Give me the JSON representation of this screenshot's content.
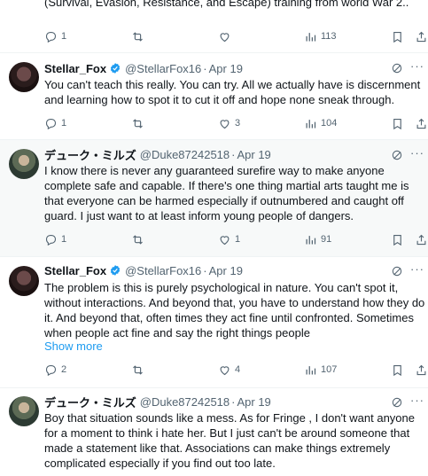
{
  "colors": {
    "text": "#0f1419",
    "secondary": "#536471",
    "link": "#1d9bf0",
    "verified": "#1d9bf0",
    "alt_bg": "#f7f9f9"
  },
  "top_tweet": {
    "text_partial": "(Survival, Evasion, Resistance, and Escape) training from world War 2..",
    "replies": "1",
    "views": "113"
  },
  "tweets": [
    {
      "name": "Stellar_Fox",
      "handle": "@StellarFox16",
      "sep": "·",
      "time": "Apr 19",
      "text": "You can't teach this really. You can try. All we actually have is discernment and learning how to spot it to cut it off and hope none sneak through.",
      "replies": "1",
      "retweets": "",
      "likes": "3",
      "views": "104"
    },
    {
      "name": "デューク・ミルズ",
      "handle": "@Duke87242518",
      "sep": "·",
      "time": "Apr 19",
      "text": "I know there is never any guaranteed surefire way to make anyone complete safe and capable. If there's one thing martial arts taught me is that everyone can be harmed especially if outnumbered and caught off guard. I just want to at least inform young people of dangers.",
      "replies": "1",
      "retweets": "",
      "likes": "1",
      "views": "91"
    },
    {
      "name": "Stellar_Fox",
      "handle": "@StellarFox16",
      "sep": "·",
      "time": "Apr 19",
      "text": "The problem is this is purely psychological in nature. You can't spot it, without interactions. And beyond that, you have to understand how they do it. And beyond that, often times they act fine until confronted. Sometimes when people act fine and say the right things people",
      "show_more": "Show more",
      "replies": "2",
      "retweets": "",
      "likes": "4",
      "views": "107"
    },
    {
      "name": "デューク・ミルズ",
      "handle": "@Duke87242518",
      "sep": "·",
      "time": "Apr 19",
      "text": "Boy that situation sounds like a mess. As for Fringe , I don't want anyone for a moment to think i hate her. But I just can't be around someone that made a statement like that. Associations can make things extremely complicated especially if you find out too late."
    }
  ]
}
